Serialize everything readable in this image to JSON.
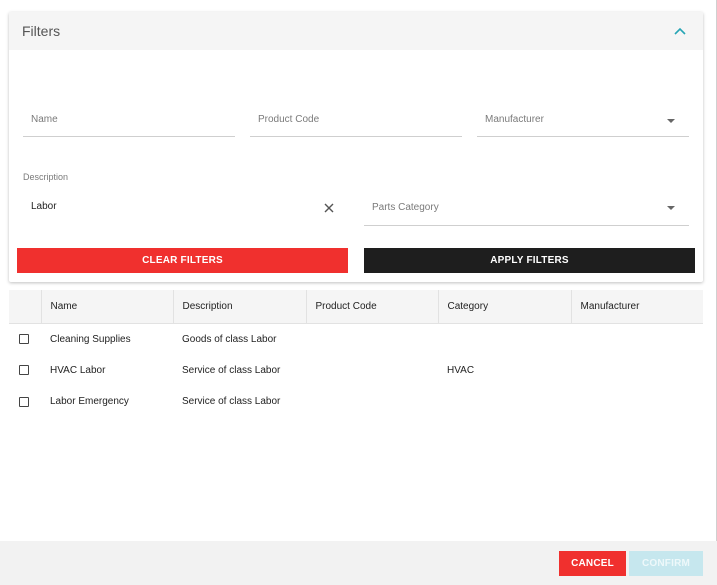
{
  "filters": {
    "title": "Filters",
    "name_placeholder": "Name",
    "product_code_placeholder": "Product Code",
    "manufacturer_placeholder": "Manufacturer",
    "description_label": "Description",
    "description_value": "Labor",
    "parts_category_placeholder": "Parts Category",
    "clear_label": "CLEAR FILTERS",
    "apply_label": "APPLY FILTERS"
  },
  "table": {
    "columns": [
      "Name",
      "Description",
      "Product Code",
      "Category",
      "Manufacturer"
    ],
    "rows": [
      {
        "name": "Cleaning Supplies",
        "description": "Goods of class Labor",
        "product_code": "",
        "category": "",
        "manufacturer": ""
      },
      {
        "name": "HVAC Labor",
        "description": "Service of class Labor",
        "product_code": "",
        "category": "HVAC",
        "manufacturer": ""
      },
      {
        "name": "Labor Emergency",
        "description": "Service of class Labor",
        "product_code": "",
        "category": "",
        "manufacturer": ""
      }
    ]
  },
  "footer": {
    "cancel_label": "CANCEL",
    "confirm_label": "CONFIRM"
  },
  "colors": {
    "danger": "#f0302e",
    "dark": "#1e1e1e",
    "accent": "#26a5b5",
    "confirm_disabled": "#c6e7ee"
  },
  "icons": {
    "collapse": "chevron-up-icon",
    "clear": "close-icon",
    "dropdown": "caret-down-icon"
  }
}
